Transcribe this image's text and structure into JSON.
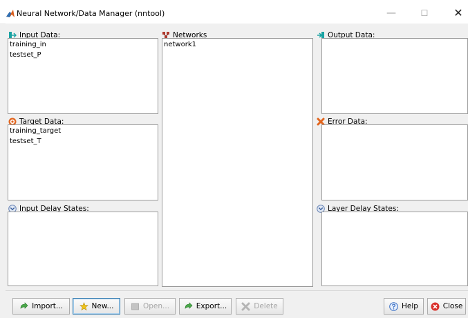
{
  "window": {
    "title": "Neural Network/Data Manager (nntool)",
    "minimize_glyph": "—",
    "maximize_glyph": "☐",
    "close_glyph": "✕"
  },
  "sections": {
    "input_data": {
      "label": "Input Data:",
      "items": [
        "training_in",
        "testset_P"
      ],
      "icon": "input-data-icon"
    },
    "target_data": {
      "label": "Target Data:",
      "items": [
        "training_target",
        "testset_T"
      ],
      "icon": "target-icon"
    },
    "input_delay_states": {
      "label": "Input Delay States:",
      "items": [],
      "icon": "chevron-circle-icon"
    },
    "networks": {
      "label": "Networks",
      "items": [
        "network1"
      ],
      "icon": "network-icon"
    },
    "output_data": {
      "label": "Output Data:",
      "items": [],
      "icon": "output-data-icon"
    },
    "error_data": {
      "label": "Error Data:",
      "items": [],
      "icon": "error-icon"
    },
    "layer_delay_states": {
      "label": "Layer Delay States:",
      "items": [],
      "icon": "chevron-circle-icon"
    }
  },
  "buttons": {
    "import": {
      "label": "Import...",
      "enabled": true,
      "icon": "import-icon"
    },
    "new": {
      "label": "New...",
      "enabled": true,
      "icon": "new-icon"
    },
    "open": {
      "label": "Open...",
      "enabled": false,
      "icon": "open-icon"
    },
    "export": {
      "label": "Export...",
      "enabled": true,
      "icon": "export-icon"
    },
    "delete": {
      "label": "Delete",
      "enabled": false,
      "icon": "delete-icon"
    },
    "help": {
      "label": "Help",
      "enabled": true,
      "icon": "help-icon"
    },
    "close": {
      "label": "Close",
      "enabled": true,
      "icon": "close-circle-icon"
    }
  },
  "colors": {
    "accent_teal": "#1aa3a3",
    "network_red": "#b03a2e",
    "target_orange": "#e2651e",
    "close_red": "#d9312b",
    "help_blue": "#3a6fc4",
    "new_yellow": "#f0c419",
    "focus_border": "#3c7fb1"
  }
}
